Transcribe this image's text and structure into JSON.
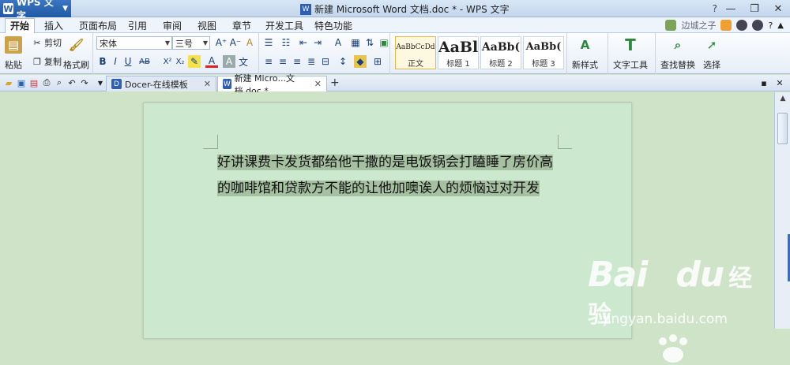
{
  "titlebar": {
    "app_menu": "WPS 文字",
    "window_title": "新建 Microsoft Word 文档.doc * - WPS 文字"
  },
  "menu": {
    "tabs": [
      "开始",
      "插入",
      "页面布局",
      "引用",
      "审阅",
      "视图",
      "章节",
      "开发工具",
      "特色功能"
    ],
    "user": "边城之子"
  },
  "ribbon": {
    "paste": "粘贴",
    "cut": "剪切",
    "copy": "复制",
    "format_painter": "格式刷",
    "font_name": "宋体",
    "font_size": "三号",
    "styles": [
      {
        "preview": "AaBbCcDd",
        "label": "正文"
      },
      {
        "preview": "AaBl",
        "label": "标题 1"
      },
      {
        "preview": "AaBb(",
        "label": "标题 2"
      },
      {
        "preview": "AaBb(",
        "label": "标题 3"
      }
    ],
    "new_style": "新样式",
    "text_tools": "文字工具",
    "find_replace": "查找替换",
    "select": "选择"
  },
  "doc_tabs": [
    {
      "label": "Docer-在线模板"
    },
    {
      "label": "新建 Micro...文档.doc *"
    }
  ],
  "document": {
    "line1": "好讲课费卡发货都给他干撒的是电饭锅会打瞌睡了房价高",
    "line2": "的咖啡馆和贷款方不能的让他加噢诶人的烦恼过对开发"
  },
  "watermark": {
    "brand": "Bai",
    "brand2": "du",
    "cn": "经验",
    "url": "jingyan.baidu.com"
  },
  "colors": {
    "page_bg": "#cce8cf",
    "highlight": "#a6c0a2",
    "accent": "#2a62b0"
  }
}
